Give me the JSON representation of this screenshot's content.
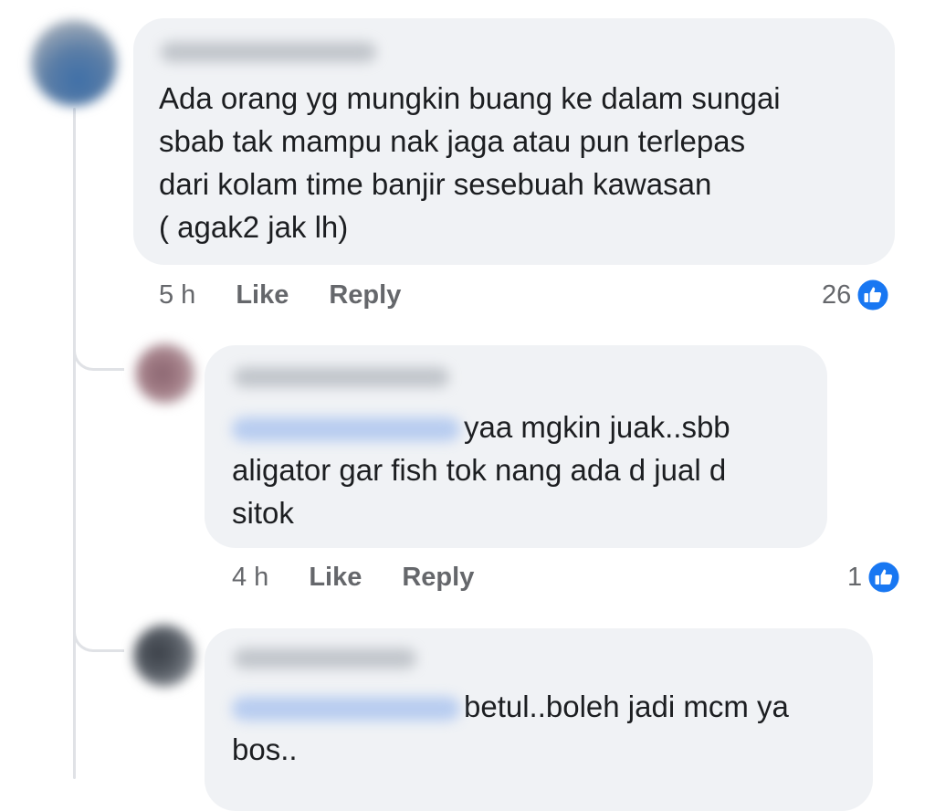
{
  "comments": [
    {
      "lines": [
        "Ada orang yg mungkin buang ke dalam sungai",
        "sbab tak mampu nak jaga atau pun terlepas",
        "dari kolam time banjir sesebuah kawasan",
        "( agak2 jak lh)"
      ],
      "time": "5 h",
      "like_label": "Like",
      "reply_label": "Reply",
      "reaction_count": "26",
      "reaction_icon": "like-icon"
    },
    {
      "lines": [
        "yaa mgkin juak..sbb",
        "aligator gar fish tok nang ada d jual d",
        "sitok"
      ],
      "time": "4 h",
      "like_label": "Like",
      "reply_label": "Reply",
      "reaction_count": "1",
      "reaction_icon": "like-icon"
    },
    {
      "lines": [
        "betul..boleh jadi mcm ya",
        "bos.."
      ]
    }
  ],
  "colors": {
    "bubble": "#f0f2f5",
    "meta_text": "#65676b",
    "like_blue": "#1877f2"
  }
}
